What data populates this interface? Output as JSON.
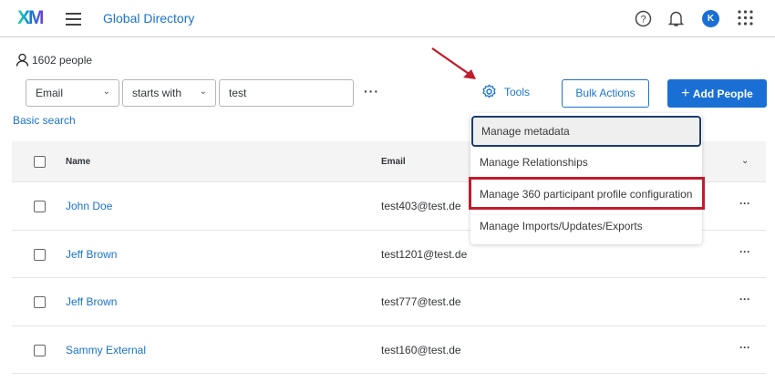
{
  "header": {
    "logo": "XM",
    "title": "Global Directory",
    "avatar": "K",
    "icons": [
      "help-icon",
      "bell-icon",
      "apps-grid-icon"
    ]
  },
  "people_count": "1602 people",
  "filter": {
    "field": "Email",
    "operator": "starts with",
    "value": "test",
    "basic_search": "Basic search"
  },
  "toolbar": {
    "tools": "Tools",
    "bulk_actions": "Bulk Actions",
    "add_people": "Add People"
  },
  "table": {
    "columns": [
      "Name",
      "Email"
    ],
    "rows": [
      {
        "name": "John Doe",
        "email": "test403@test.de"
      },
      {
        "name": "Jeff Brown",
        "email": "test1201@test.de"
      },
      {
        "name": "Jeff Brown",
        "email": "test777@test.de"
      },
      {
        "name": "Sammy External",
        "email": "test160@test.de"
      }
    ]
  },
  "tools_menu": [
    "Manage metadata",
    "Manage Relationships",
    "Manage 360 participant profile configuration",
    "Manage Imports/Updates/Exports"
  ],
  "colors": {
    "accent": "#1a6fd4",
    "highlight": "#c01c2c"
  }
}
